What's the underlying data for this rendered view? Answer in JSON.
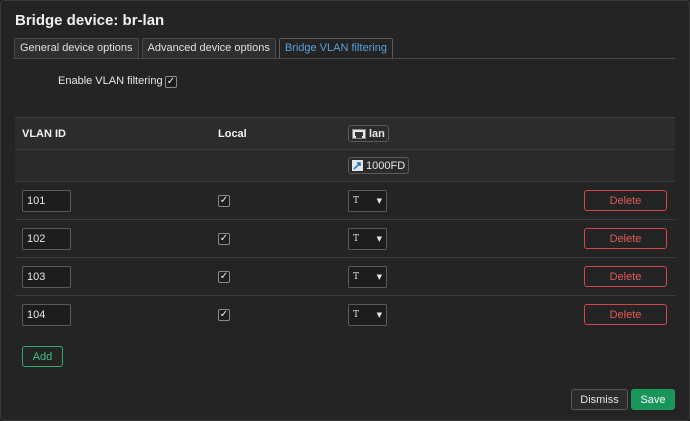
{
  "dialog": {
    "title": "Bridge device: br-lan"
  },
  "tabs": [
    {
      "label": "General device options"
    },
    {
      "label": "Advanced device options"
    },
    {
      "label": "Bridge VLAN filtering"
    }
  ],
  "vlan_filtering": {
    "label": "Enable VLAN filtering",
    "checked": true
  },
  "table": {
    "headers": {
      "vlan_id": "VLAN ID",
      "local": "Local"
    },
    "port": {
      "name": "lan",
      "icon": "network-port-icon",
      "speed": "1000FD",
      "speed_icon": "port-speed-icon"
    },
    "rows": [
      {
        "vlan_id": "101",
        "local": true,
        "tag": "T"
      },
      {
        "vlan_id": "102",
        "local": true,
        "tag": "T"
      },
      {
        "vlan_id": "103",
        "local": true,
        "tag": "T"
      },
      {
        "vlan_id": "104",
        "local": true,
        "tag": "T"
      }
    ],
    "delete_label": "Delete"
  },
  "buttons": {
    "add": "Add",
    "dismiss": "Dismiss",
    "save": "Save"
  },
  "colors": {
    "accent": "#5aa0d8",
    "danger": "#d04848",
    "success": "#17955a"
  }
}
